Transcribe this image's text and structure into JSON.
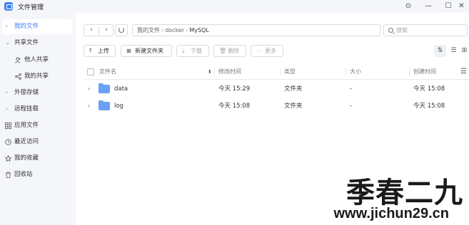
{
  "window": {
    "title": "文件管理",
    "controls": {
      "pin": "⊙",
      "minimize": "—",
      "maximize": "☐",
      "close": "✕"
    }
  },
  "sidebar": {
    "items": [
      {
        "label": "我的文件",
        "chevron": "›",
        "active": true
      },
      {
        "label": "共享文件",
        "chevron": "⌄",
        "active": false
      },
      {
        "label": "他人共享",
        "icon": "users-icon"
      },
      {
        "label": "我的共享",
        "icon": "share-icon"
      },
      {
        "label": "外接存储",
        "chevron": "›"
      },
      {
        "label": "远程挂载",
        "chevron": "›"
      },
      {
        "label": "应用文件",
        "icon": "apps-icon"
      },
      {
        "label": "最近访问",
        "icon": "clock-icon"
      },
      {
        "label": "我的收藏",
        "icon": "star-icon"
      },
      {
        "label": "回收站",
        "icon": "trash-icon"
      }
    ]
  },
  "nav": {
    "back": "‹",
    "forward": "›"
  },
  "path": {
    "crumbs": [
      "我的文件",
      "docker",
      "MySQL"
    ],
    "sep": "›"
  },
  "search": {
    "placeholder": "搜索"
  },
  "toolbar": {
    "upload": {
      "label": "上传",
      "icon": "⤒"
    },
    "new_folder": {
      "label": "新建文件夹",
      "icon": "⊞"
    },
    "download": {
      "label": "下载",
      "icon": "⤓"
    },
    "delete": {
      "label": "删除",
      "icon": "🗑"
    },
    "more": {
      "label": "更多",
      "icon": "⋯"
    }
  },
  "view": {
    "sort": "⇅",
    "list": "☰",
    "grid": "⊞"
  },
  "table": {
    "headers": {
      "name": "文件名",
      "modified": "修改时间",
      "type": "类型",
      "size": "大小",
      "created": "创建时间"
    },
    "rows": [
      {
        "name": "data",
        "modified": "今天 15:29",
        "type": "文件夹",
        "size": "-",
        "created": "今天 15:08"
      },
      {
        "name": "log",
        "modified": "今天 15:08",
        "type": "文件夹",
        "size": "-",
        "created": "今天 15:08"
      }
    ]
  },
  "watermark": {
    "text": "季春二九",
    "url": "www.jichun29.cn"
  },
  "colors": {
    "accent": "#3b82f6",
    "folder": "#6aa0f5",
    "sidebar_bg": "#f4f6f9"
  }
}
